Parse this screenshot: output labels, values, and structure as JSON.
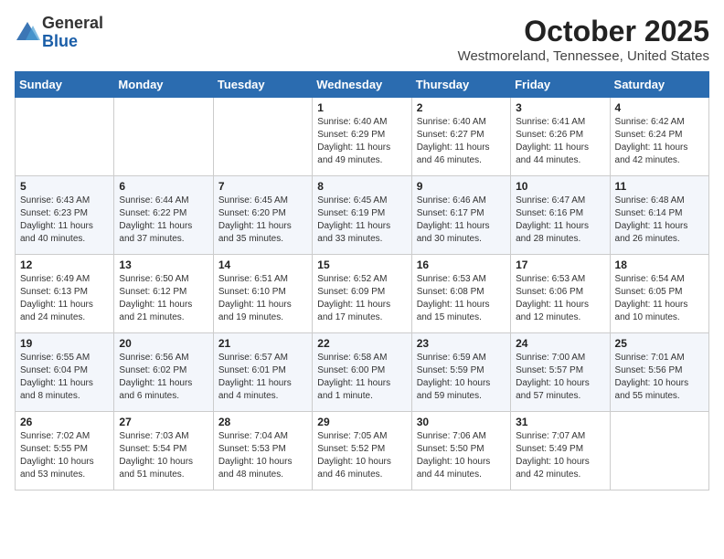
{
  "header": {
    "logo_line1": "General",
    "logo_line2": "Blue",
    "month": "October 2025",
    "location": "Westmoreland, Tennessee, United States"
  },
  "weekdays": [
    "Sunday",
    "Monday",
    "Tuesday",
    "Wednesday",
    "Thursday",
    "Friday",
    "Saturday"
  ],
  "weeks": [
    [
      {
        "day": "",
        "info": ""
      },
      {
        "day": "",
        "info": ""
      },
      {
        "day": "",
        "info": ""
      },
      {
        "day": "1",
        "info": "Sunrise: 6:40 AM\nSunset: 6:29 PM\nDaylight: 11 hours\nand 49 minutes."
      },
      {
        "day": "2",
        "info": "Sunrise: 6:40 AM\nSunset: 6:27 PM\nDaylight: 11 hours\nand 46 minutes."
      },
      {
        "day": "3",
        "info": "Sunrise: 6:41 AM\nSunset: 6:26 PM\nDaylight: 11 hours\nand 44 minutes."
      },
      {
        "day": "4",
        "info": "Sunrise: 6:42 AM\nSunset: 6:24 PM\nDaylight: 11 hours\nand 42 minutes."
      }
    ],
    [
      {
        "day": "5",
        "info": "Sunrise: 6:43 AM\nSunset: 6:23 PM\nDaylight: 11 hours\nand 40 minutes."
      },
      {
        "day": "6",
        "info": "Sunrise: 6:44 AM\nSunset: 6:22 PM\nDaylight: 11 hours\nand 37 minutes."
      },
      {
        "day": "7",
        "info": "Sunrise: 6:45 AM\nSunset: 6:20 PM\nDaylight: 11 hours\nand 35 minutes."
      },
      {
        "day": "8",
        "info": "Sunrise: 6:45 AM\nSunset: 6:19 PM\nDaylight: 11 hours\nand 33 minutes."
      },
      {
        "day": "9",
        "info": "Sunrise: 6:46 AM\nSunset: 6:17 PM\nDaylight: 11 hours\nand 30 minutes."
      },
      {
        "day": "10",
        "info": "Sunrise: 6:47 AM\nSunset: 6:16 PM\nDaylight: 11 hours\nand 28 minutes."
      },
      {
        "day": "11",
        "info": "Sunrise: 6:48 AM\nSunset: 6:14 PM\nDaylight: 11 hours\nand 26 minutes."
      }
    ],
    [
      {
        "day": "12",
        "info": "Sunrise: 6:49 AM\nSunset: 6:13 PM\nDaylight: 11 hours\nand 24 minutes."
      },
      {
        "day": "13",
        "info": "Sunrise: 6:50 AM\nSunset: 6:12 PM\nDaylight: 11 hours\nand 21 minutes."
      },
      {
        "day": "14",
        "info": "Sunrise: 6:51 AM\nSunset: 6:10 PM\nDaylight: 11 hours\nand 19 minutes."
      },
      {
        "day": "15",
        "info": "Sunrise: 6:52 AM\nSunset: 6:09 PM\nDaylight: 11 hours\nand 17 minutes."
      },
      {
        "day": "16",
        "info": "Sunrise: 6:53 AM\nSunset: 6:08 PM\nDaylight: 11 hours\nand 15 minutes."
      },
      {
        "day": "17",
        "info": "Sunrise: 6:53 AM\nSunset: 6:06 PM\nDaylight: 11 hours\nand 12 minutes."
      },
      {
        "day": "18",
        "info": "Sunrise: 6:54 AM\nSunset: 6:05 PM\nDaylight: 11 hours\nand 10 minutes."
      }
    ],
    [
      {
        "day": "19",
        "info": "Sunrise: 6:55 AM\nSunset: 6:04 PM\nDaylight: 11 hours\nand 8 minutes."
      },
      {
        "day": "20",
        "info": "Sunrise: 6:56 AM\nSunset: 6:02 PM\nDaylight: 11 hours\nand 6 minutes."
      },
      {
        "day": "21",
        "info": "Sunrise: 6:57 AM\nSunset: 6:01 PM\nDaylight: 11 hours\nand 4 minutes."
      },
      {
        "day": "22",
        "info": "Sunrise: 6:58 AM\nSunset: 6:00 PM\nDaylight: 11 hours\nand 1 minute."
      },
      {
        "day": "23",
        "info": "Sunrise: 6:59 AM\nSunset: 5:59 PM\nDaylight: 10 hours\nand 59 minutes."
      },
      {
        "day": "24",
        "info": "Sunrise: 7:00 AM\nSunset: 5:57 PM\nDaylight: 10 hours\nand 57 minutes."
      },
      {
        "day": "25",
        "info": "Sunrise: 7:01 AM\nSunset: 5:56 PM\nDaylight: 10 hours\nand 55 minutes."
      }
    ],
    [
      {
        "day": "26",
        "info": "Sunrise: 7:02 AM\nSunset: 5:55 PM\nDaylight: 10 hours\nand 53 minutes."
      },
      {
        "day": "27",
        "info": "Sunrise: 7:03 AM\nSunset: 5:54 PM\nDaylight: 10 hours\nand 51 minutes."
      },
      {
        "day": "28",
        "info": "Sunrise: 7:04 AM\nSunset: 5:53 PM\nDaylight: 10 hours\nand 48 minutes."
      },
      {
        "day": "29",
        "info": "Sunrise: 7:05 AM\nSunset: 5:52 PM\nDaylight: 10 hours\nand 46 minutes."
      },
      {
        "day": "30",
        "info": "Sunrise: 7:06 AM\nSunset: 5:50 PM\nDaylight: 10 hours\nand 44 minutes."
      },
      {
        "day": "31",
        "info": "Sunrise: 7:07 AM\nSunset: 5:49 PM\nDaylight: 10 hours\nand 42 minutes."
      },
      {
        "day": "",
        "info": ""
      }
    ]
  ]
}
